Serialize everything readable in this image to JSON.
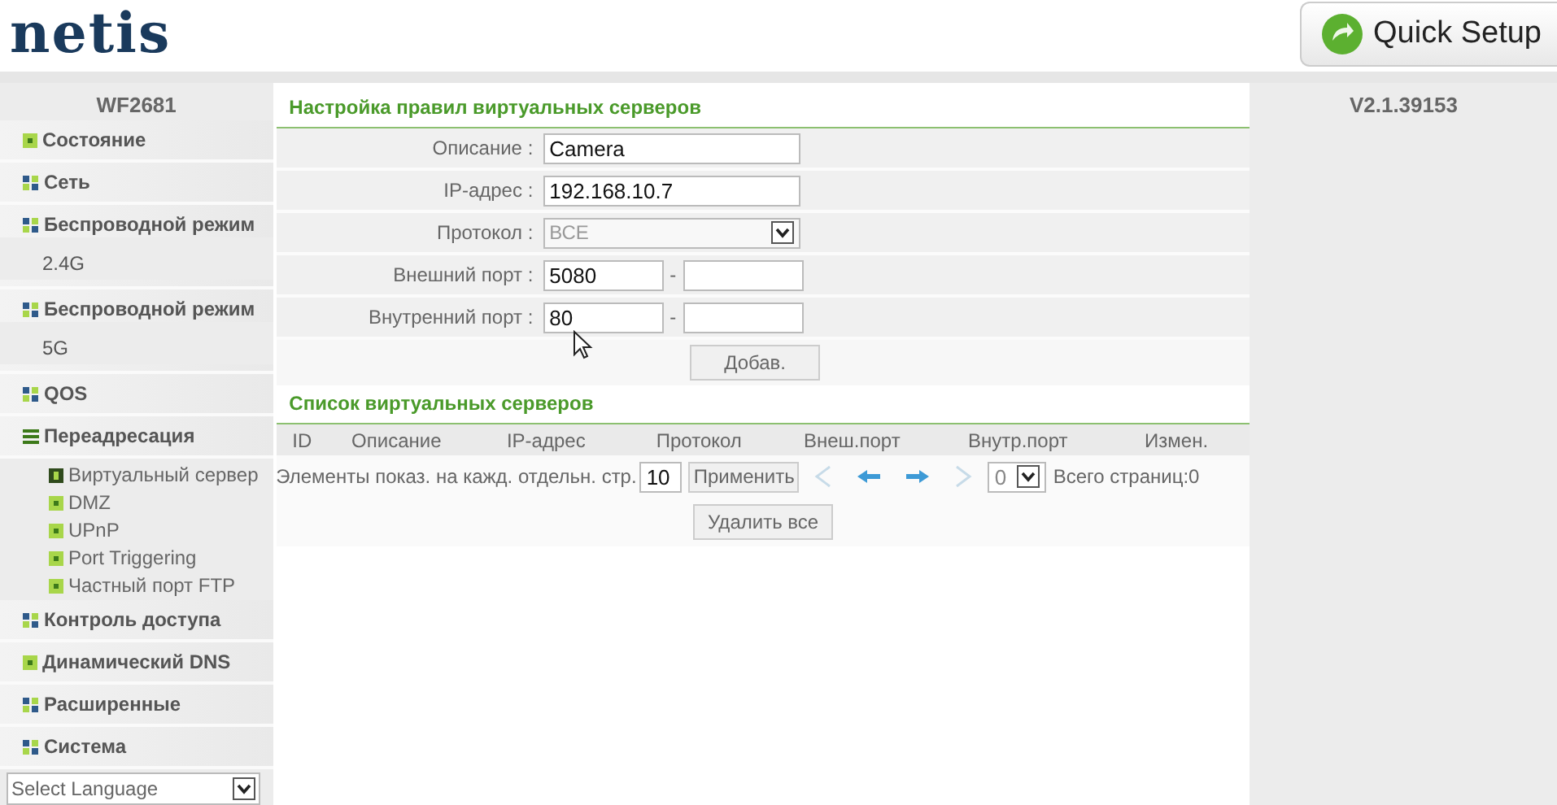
{
  "header": {
    "logo": "netis",
    "quick_setup": "Quick Setup"
  },
  "sidebar": {
    "model": "WF2681",
    "items": [
      {
        "label": "Состояние",
        "kind": "page"
      },
      {
        "label": "Сеть",
        "kind": "group",
        "expanded": false
      },
      {
        "label": "Беспроводной режим",
        "band": "2.4G",
        "kind": "group",
        "expanded": false
      },
      {
        "label": "Беспроводной режим",
        "band": "5G",
        "kind": "group",
        "expanded": false
      },
      {
        "label": "QOS",
        "kind": "group",
        "expanded": false
      },
      {
        "label": "Переадресация",
        "kind": "group",
        "expanded": true,
        "children": [
          {
            "label": "Виртуальный сервер",
            "selected": true
          },
          {
            "label": "DMZ",
            "selected": false
          },
          {
            "label": "UPnP",
            "selected": false
          },
          {
            "label": "Port Triggering",
            "selected": false
          },
          {
            "label": "Частный порт FTP",
            "selected": false
          }
        ]
      },
      {
        "label": "Контроль доступа",
        "kind": "group",
        "expanded": false
      },
      {
        "label": "Динамический DNS",
        "kind": "page"
      },
      {
        "label": "Расширенные",
        "kind": "group",
        "expanded": false
      },
      {
        "label": "Система",
        "kind": "group",
        "expanded": false
      }
    ],
    "language": "Select Language"
  },
  "form": {
    "title": "Настройка правил виртуальных серверов",
    "fields": [
      {
        "label": "Описание :",
        "kind": "text",
        "value": "Camera"
      },
      {
        "label": "IP-адрес :",
        "kind": "text",
        "value": "192.168.10.7"
      },
      {
        "label": "Протокол :",
        "kind": "select",
        "value": "ВСЕ",
        "disabled": true
      },
      {
        "label": "Внешний порт :",
        "kind": "range",
        "value": "5080",
        "separator": "-"
      },
      {
        "label": "Внутренний порт :",
        "kind": "range",
        "value": "80",
        "separator": "-"
      }
    ],
    "add_button": "Добав."
  },
  "list": {
    "title": "Список виртуальных серверов",
    "columns": [
      "ID",
      "Описание",
      "IP-адрес",
      "Протокол",
      "Внеш.порт",
      "Внутр.порт",
      "Измен."
    ],
    "pager": {
      "label": "Элементы показ. на кажд. отдельн. стр.",
      "per_page": "10",
      "apply": "Применить",
      "page": "0",
      "total": "Всего страниц:0"
    },
    "delete_all": "Удалить все"
  },
  "version": "V2.1.39153"
}
